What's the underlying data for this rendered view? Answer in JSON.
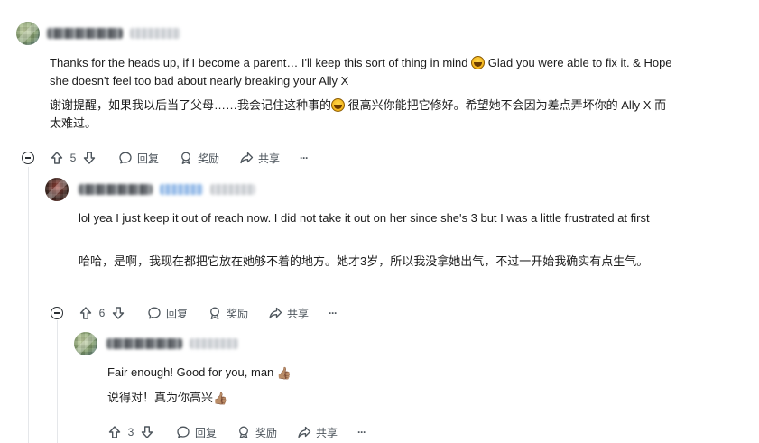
{
  "comments": [
    {
      "text_en": "Thanks for the heads up, if I become a parent… I'll keep this sort of thing in mind",
      "text_en_after": " Glad you were able to fix it. & Hope she doesn't feel too bad about nearly breaking your Ally X",
      "text_zh": "谢谢提醒，如果我以后当了父母……我会记住这种事的",
      "text_zh_after": " 很高兴你能把它修好。希望她不会因为差点弄坏你的 Ally X 而太难过。",
      "votes": "5",
      "emoji": "grinning-squinting-emoji"
    },
    {
      "text_en": "lol yea I just keep it out of reach now. I did not take it out on her since she's 3 but I was a little frustrated at first",
      "text_zh": "哈哈，是啊，我现在都把它放在她够不着的地方。她才3岁，所以我没拿她出气，不过一开始我确实有点生气。",
      "votes": "6"
    },
    {
      "text_en": "Fair enough! Good for you, man ",
      "text_en_emoji": "👍🏽",
      "text_zh": "说得对！真为你高兴",
      "text_zh_emoji": "👍🏽",
      "votes": "3"
    }
  ],
  "actions": {
    "reply": "回复",
    "award": "奖励",
    "share": "共享",
    "more": "···"
  },
  "colors": {
    "text": "#1c1c1c",
    "muted": "#4d555c",
    "thread_line": "#e5e7ea"
  },
  "icons": {
    "upvote": "arrow-up-icon",
    "downvote": "arrow-down-icon",
    "reply": "speech-bubble-icon",
    "award": "award-ribbon-icon",
    "share": "share-arrow-icon",
    "collapse": "minus-circle-icon"
  }
}
